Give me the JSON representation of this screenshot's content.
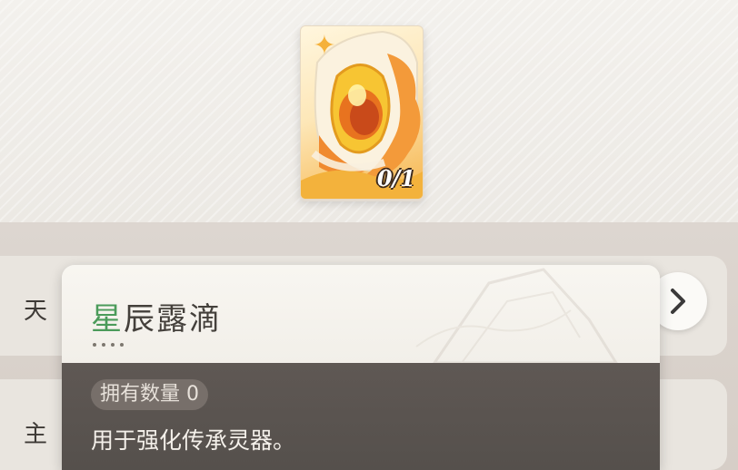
{
  "item": {
    "count_text": "0/1",
    "name_first_char": "星",
    "name_rest": "辰露滴",
    "owned_label": "拥有数量 0",
    "description": "用于强化传承灵器。"
  },
  "list": {
    "row1_label": "天",
    "row2_label": "主"
  },
  "icons": {
    "card_image": "golden-dewdrop-icon",
    "next_button": "chevron-right-icon"
  },
  "colors": {
    "title_accent": "#4b9b5a",
    "popup_body": "#5a534f",
    "card_gold": "#f6b44a"
  }
}
